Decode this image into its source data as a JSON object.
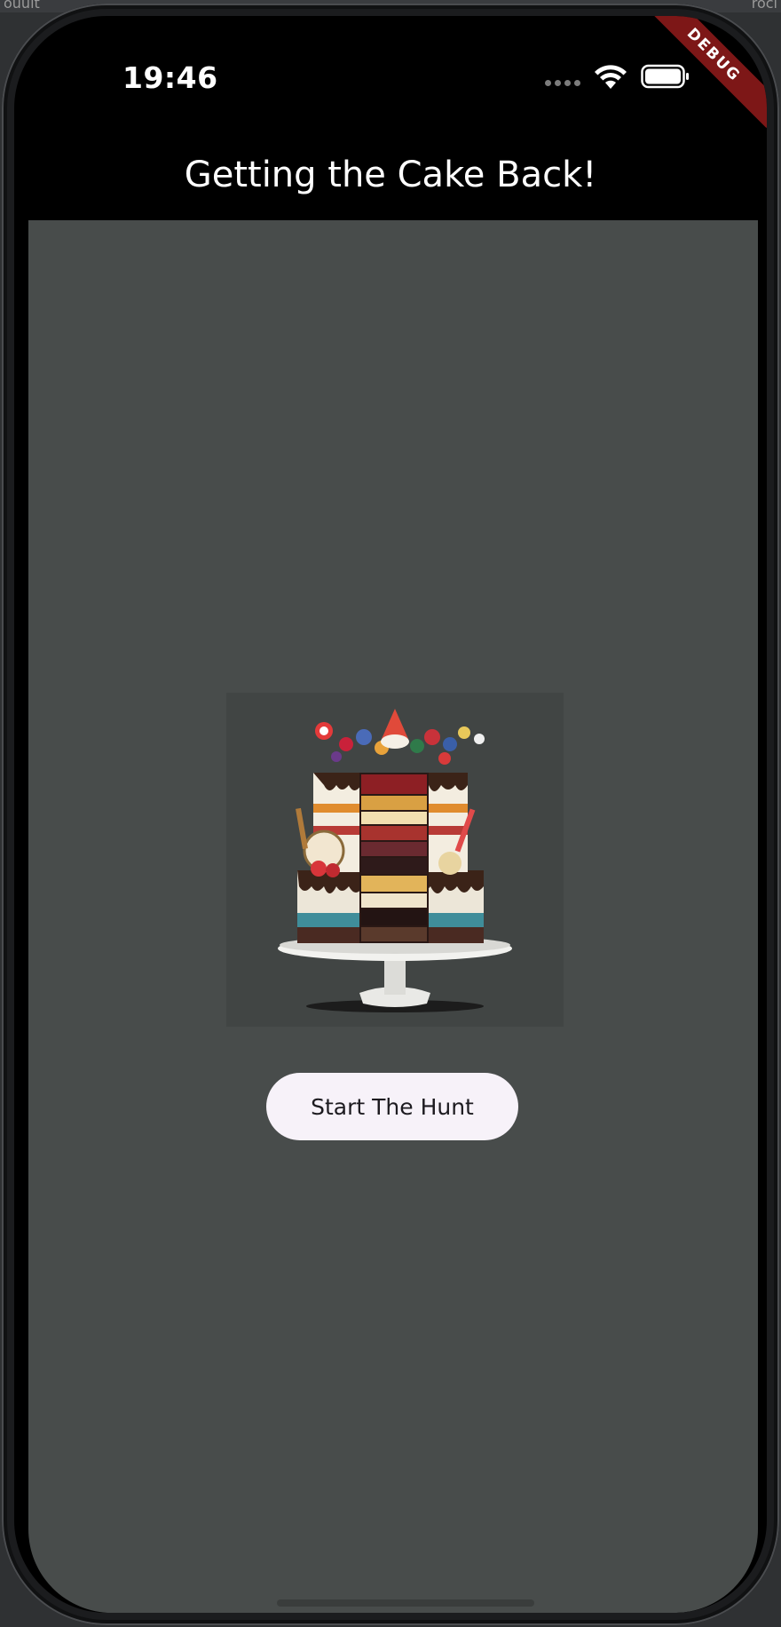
{
  "host": {
    "left_text": "ouuit",
    "right_text": "roci"
  },
  "status_bar": {
    "time": "19:46"
  },
  "debug_banner": {
    "label": "DEBUG"
  },
  "app_bar": {
    "title": "Getting the Cake Back!"
  },
  "main": {
    "image": {
      "icon": "layered-cake-illustration"
    },
    "start_button": {
      "label": "Start The Hunt"
    }
  },
  "colors": {
    "app_bar": "#000000",
    "content_background": "#484c4b",
    "button_background": "#f7f2f9",
    "debug_ribbon": "#7d1717"
  }
}
